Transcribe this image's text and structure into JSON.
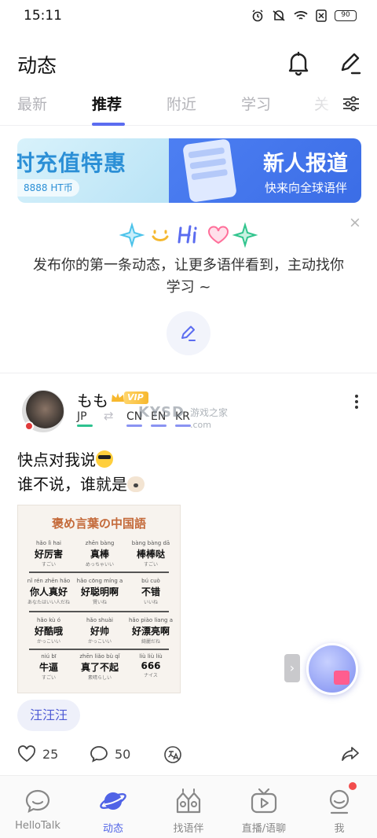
{
  "status_bar": {
    "time": "15:11",
    "battery": "90"
  },
  "header": {
    "title": "动态"
  },
  "tabs": [
    {
      "label": "最新"
    },
    {
      "label": "推荐"
    },
    {
      "label": "附近"
    },
    {
      "label": "学习"
    },
    {
      "label": "关"
    }
  ],
  "active_tab": "推荐",
  "banner": {
    "left_title": "时充值特惠",
    "left_sub": "8888 HT币",
    "right_title": "新人报道",
    "right_sub": "快来向全球语伴"
  },
  "empty_prompt": {
    "text": "发布你的第一条动态，让更多语伴看到，主动找你学习 ~",
    "close": "×"
  },
  "post": {
    "username": "もも",
    "vip_label": "VIP",
    "native_lang": "JP",
    "learning_langs": [
      "CN",
      "EN",
      "KR"
    ],
    "text_line1": "快点对我说",
    "text_line2": "谁不说，谁就是",
    "image": {
      "title": "褒め言葉の中国語",
      "rows": [
        [
          {
            "py": "hǎo lì hai",
            "cn": "好厉害",
            "jp": "すごい"
          },
          {
            "py": "zhēn bàng",
            "cn": "真棒",
            "jp": "めっちゃいい"
          },
          {
            "py": "bàng bàng dā",
            "cn": "棒棒哒",
            "jp": "すごい"
          }
        ],
        [
          {
            "py": "nǐ rén zhēn hǎo",
            "cn": "你人真好",
            "jp": "あなたはいい人だね"
          },
          {
            "py": "hǎo cōng míng a",
            "cn": "好聪明啊",
            "jp": "賢いね"
          },
          {
            "py": "bú cuò",
            "cn": "不错",
            "jp": "いいね"
          }
        ],
        [
          {
            "py": "hǎo kù ó",
            "cn": "好酷哦",
            "jp": "かっこいい"
          },
          {
            "py": "hǎo shuài",
            "cn": "好帅",
            "jp": "かっこいい"
          },
          {
            "py": "hǎo piào liang a",
            "cn": "好漂亮啊",
            "jp": "綺麗だね"
          }
        ],
        [
          {
            "py": "niú bī",
            "cn": "牛逼",
            "jp": "すごい"
          },
          {
            "py": "zhēn liǎo bù qǐ",
            "cn": "真了不起",
            "jp": "素晴らしい"
          },
          {
            "py": "liù liù liù",
            "cn": "666",
            "jp": "ナイス"
          }
        ]
      ]
    },
    "tag": "汪汪汪",
    "likes": "25",
    "comments": "50"
  },
  "watermark": {
    "main": "KYSD",
    "small1": "游戏之家",
    "small2": ".com"
  },
  "nav": [
    {
      "label": "HelloTalk",
      "icon": "chat-bubble-icon"
    },
    {
      "label": "动态",
      "icon": "planet-icon"
    },
    {
      "label": "找语伴",
      "icon": "find-partner-icon"
    },
    {
      "label": "直播/语聊",
      "icon": "live-tv-icon"
    },
    {
      "label": "我",
      "icon": "profile-icon"
    }
  ],
  "colors": {
    "accent": "#5b6cf0",
    "brand_blue": "#3b6de6",
    "badge_red": "#f24c4c"
  }
}
